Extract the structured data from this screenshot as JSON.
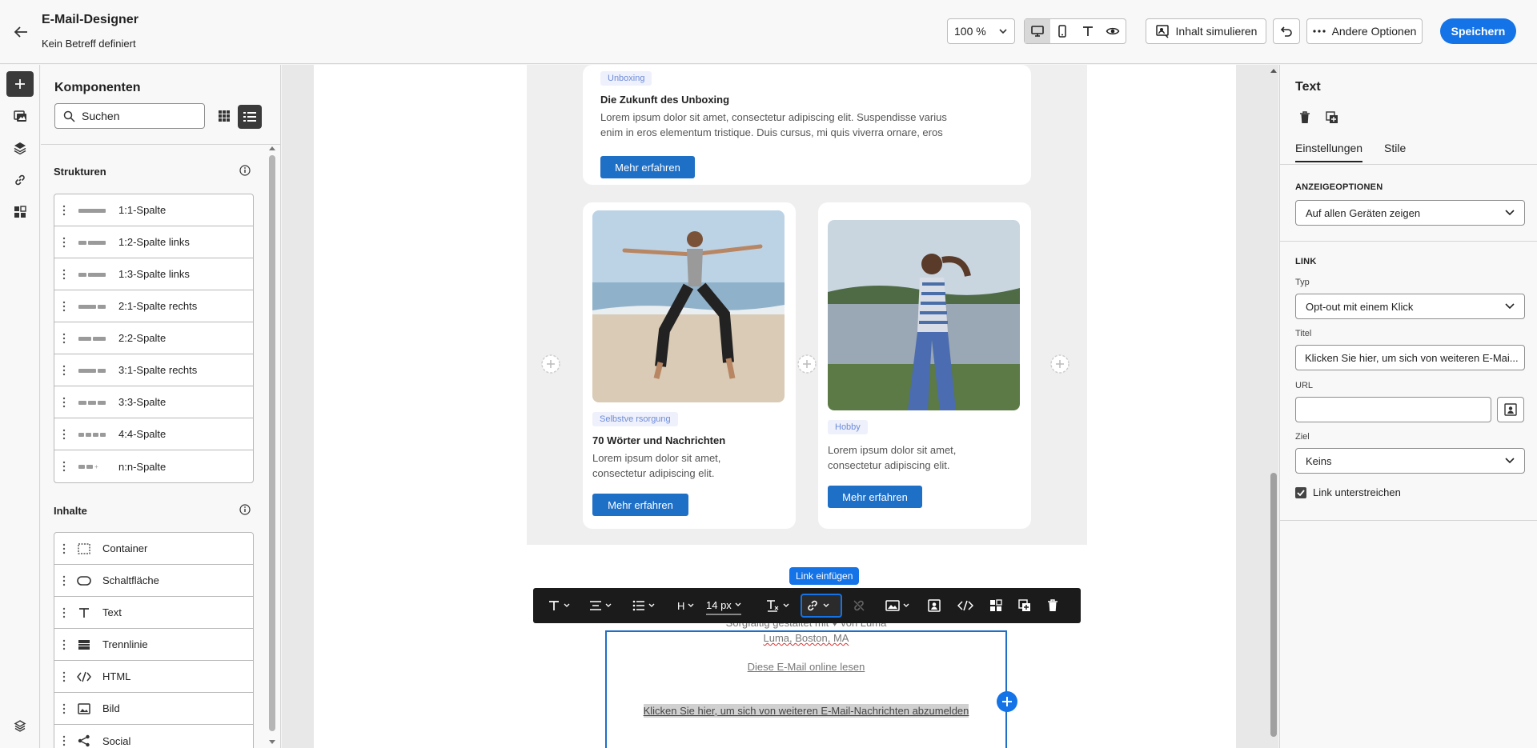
{
  "header": {
    "title": "E-Mail-Designer",
    "subtitle": "Kein Betreff definiert",
    "zoom": "100 %",
    "simulate_label": "Inhalt simulieren",
    "options_label": "Andere Optionen",
    "save_label": "Speichern"
  },
  "components": {
    "title": "Komponenten",
    "search_placeholder": "Suchen",
    "structures_label": "Strukturen",
    "structures": [
      {
        "label": "1:1-Spalte"
      },
      {
        "label": "1:2-Spalte links"
      },
      {
        "label": "1:3-Spalte links"
      },
      {
        "label": "2:1-Spalte rechts"
      },
      {
        "label": "2:2-Spalte"
      },
      {
        "label": "3:1-Spalte rechts"
      },
      {
        "label": "3:3-Spalte"
      },
      {
        "label": "4:4-Spalte"
      },
      {
        "label": "n:n-Spalte"
      }
    ],
    "contents_label": "Inhalte",
    "contents": [
      {
        "label": "Container",
        "icon": "container-icon"
      },
      {
        "label": "Schaltfläche",
        "icon": "button-icon"
      },
      {
        "label": "Text",
        "icon": "text-icon"
      },
      {
        "label": "Trennlinie",
        "icon": "divider-icon"
      },
      {
        "label": "HTML",
        "icon": "code-icon"
      },
      {
        "label": "Bild",
        "icon": "image-icon"
      },
      {
        "label": "Social",
        "icon": "share-icon"
      }
    ]
  },
  "canvas": {
    "top_card": {
      "tag": "Unboxing",
      "title": "Die Zukunft des Unboxing",
      "body_line1": "Lorem ipsum dolor sit amet, consectetur adipiscing elit. Suspendisse varius",
      "body_line2": "enim in eros elementum tristique. Duis cursus, mi quis viverra ornare, eros",
      "button": "Mehr erfahren"
    },
    "left_card": {
      "tag": "Selbstve rsorgung",
      "title": "70 Wörter und Nachrichten",
      "body_line1": "Lorem ipsum dolor sit amet,",
      "body_line2": "consectetur adipiscing elit.",
      "button": "Mehr erfahren"
    },
    "right_card": {
      "tag": "Hobby",
      "body_line1": "Lorem ipsum dolor sit amet,",
      "body_line2": "consectetur adipiscing elit.",
      "button": "Mehr erfahren"
    },
    "footer": {
      "crafted_prefix": "Sorgfältig gestaltet mit &hearts; von ",
      "crafted": "Sorgfältig gestaltet mit ♥ von Luma",
      "address": "Luma, Boston, MA",
      "online_link": "Diese E-Mail online lesen",
      "unsubscribe": "Klicken Sie hier, um sich von weiteren E-Mail-Nachrichten abzumelden"
    },
    "toolbar": {
      "font_size": "14 px",
      "heading": "H",
      "tooltip": "Link einfügen"
    }
  },
  "properties": {
    "title": "Text",
    "tab_settings": "Einstellungen",
    "tab_styles": "Stile",
    "display_section": "ANZEIGEOPTIONEN",
    "display_value": "Auf allen Geräten zeigen",
    "link_section": "LINK",
    "type_label": "Typ",
    "type_value": "Opt-out mit einem Klick",
    "title_label": "Titel",
    "title_value": "Klicken Sie hier, um sich von weiteren E-Mai...",
    "url_label": "URL",
    "url_value": "",
    "target_label": "Ziel",
    "target_value": "Keins",
    "underline_label": "Link unterstreichen",
    "underline_checked": true
  },
  "colors": {
    "accent": "#1473e6",
    "button": "#1e6fc6",
    "tag_text": "#6e8bd8"
  }
}
